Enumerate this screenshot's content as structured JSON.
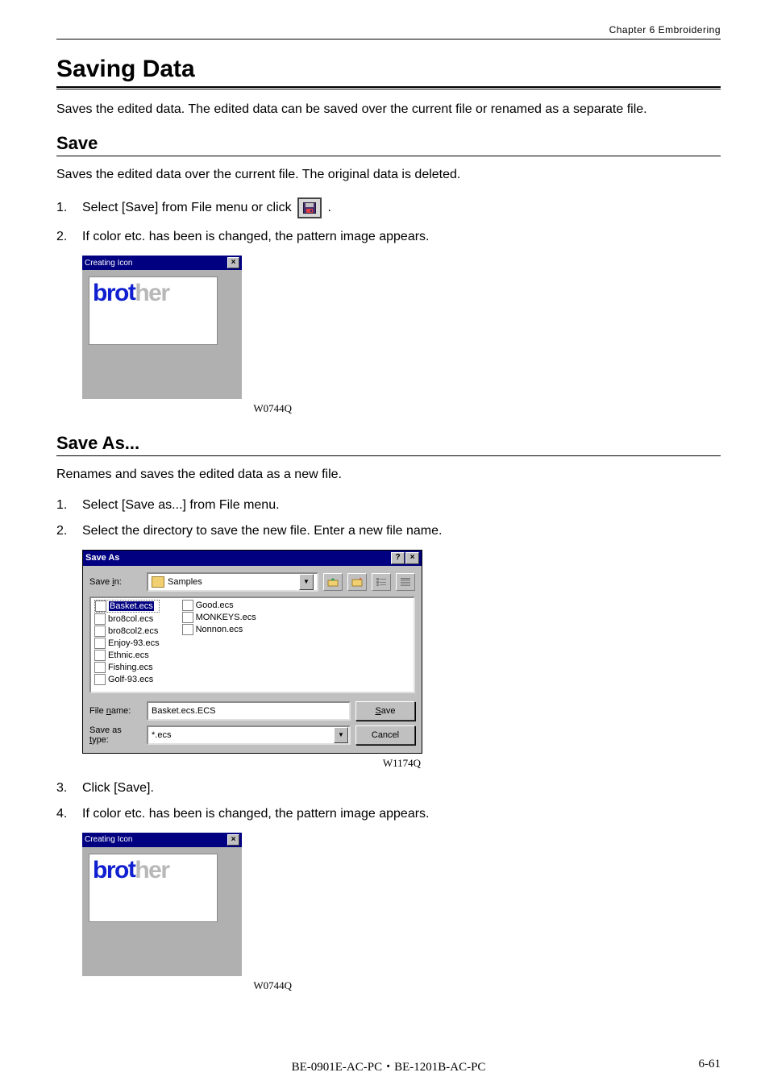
{
  "header": {
    "chapter": "Chapter 6   Embroidering"
  },
  "h1": "Saving Data",
  "intro": "Saves the edited data.    The edited data can be saved over the current file or renamed as a separate file.",
  "save": {
    "heading": "Save",
    "desc": "Saves the edited data over the current file.    The original data is deleted.",
    "step1_pre": "Select [Save] from File menu or click ",
    "step1_post": ".",
    "step2": "If color etc. has been is changed, the pattern image appears."
  },
  "creating_icon": {
    "title": "Creating Icon",
    "logo_blue": "bro",
    "logo_t": "t",
    "logo_gray": "her",
    "caption": "W0744Q"
  },
  "saveas": {
    "heading": "Save As...",
    "desc": "Renames and saves the edited data as a new file.",
    "step1": "Select [Save as...] from File menu.",
    "step2": "Select the directory to save the new file.    Enter a new file name.",
    "step3": "Click [Save].",
    "step4": "If color etc. has been is changed, the pattern image appears."
  },
  "saveas_dialog": {
    "title": "Save As",
    "help": "?",
    "close": "×",
    "savein_label": "Save in:",
    "savein_value": "Samples",
    "files_col1": [
      "Basket.ecs",
      "bro8col.ecs",
      "bro8col2.ecs",
      "Enjoy-93.ecs",
      "Ethnic.ecs",
      "Fishing.ecs",
      "Golf-93.ecs"
    ],
    "files_col2": [
      "Good.ecs",
      "MONKEYS.ecs",
      "Nonnon.ecs"
    ],
    "filename_label": "File name:",
    "filename_value": "Basket.ecs.ECS",
    "savetype_label": "Save as type:",
    "savetype_value": "*.ecs",
    "save_btn": "Save",
    "cancel_btn": "Cancel",
    "caption": "W1174Q"
  },
  "footer": {
    "center": "BE-0901E-AC-PC・BE-1201B-AC-PC",
    "right": "6-61"
  }
}
